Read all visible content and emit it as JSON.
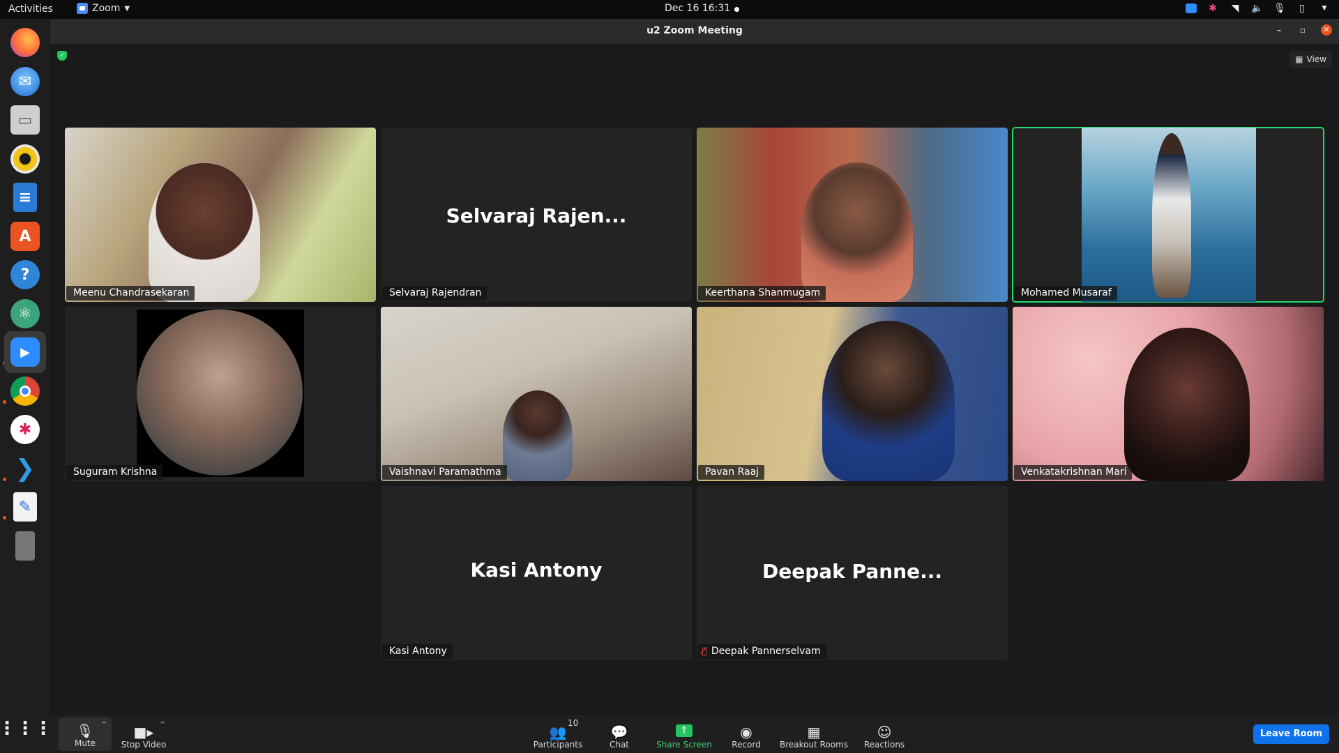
{
  "topbar": {
    "activities": "Activities",
    "app_menu": "Zoom",
    "clock": "Dec 16  16:31"
  },
  "dock": {
    "items": [
      "firefox-icon",
      "thunderbird-icon",
      "files-icon",
      "rhythmbox-icon",
      "writer-icon",
      "software-icon",
      "help-icon",
      "atom-icon",
      "zoom-icon",
      "chrome-icon",
      "slack-icon",
      "vscode-icon",
      "text-editor-icon",
      "trash-icon",
      "app-grid-icon"
    ]
  },
  "window": {
    "title": "u2  Zoom Meeting",
    "view_label": "View"
  },
  "participants": [
    {
      "name": "Meenu Chandrasekaran",
      "video": true
    },
    {
      "name": "Selvaraj Rajendran",
      "display": "Selvaraj Rajen...",
      "video": false
    },
    {
      "name": "Keerthana Shanmugam",
      "video": true
    },
    {
      "name": "Mohamed Musaraf",
      "video": true,
      "active_speaker": true
    },
    {
      "name": "Suguram Krishna",
      "video": true
    },
    {
      "name": "Vaishnavi Paramathma",
      "video": true
    },
    {
      "name": "Pavan Raaj",
      "video": true
    },
    {
      "name": "Venkatakrishnan Mari",
      "video": true
    },
    {
      "name": "Kasi Antony",
      "display": "Kasi Antony",
      "video": false
    },
    {
      "name": "Deepak Pannerselvam",
      "display": "Deepak Panne...",
      "video": false,
      "muted": true
    }
  ],
  "toolbar": {
    "mute": "Mute",
    "stop_video": "Stop Video",
    "participants": "Participants",
    "participant_count": "10",
    "chat": "Chat",
    "share_screen": "Share Screen",
    "record": "Record",
    "breakout_rooms": "Breakout Rooms",
    "reactions": "Reactions",
    "leave_room": "Leave Room"
  },
  "colors": {
    "accent_blue": "#0e72ed",
    "share_green": "#22c55e",
    "speaker_outline": "#23d96c",
    "ubuntu_orange": "#e95420"
  }
}
